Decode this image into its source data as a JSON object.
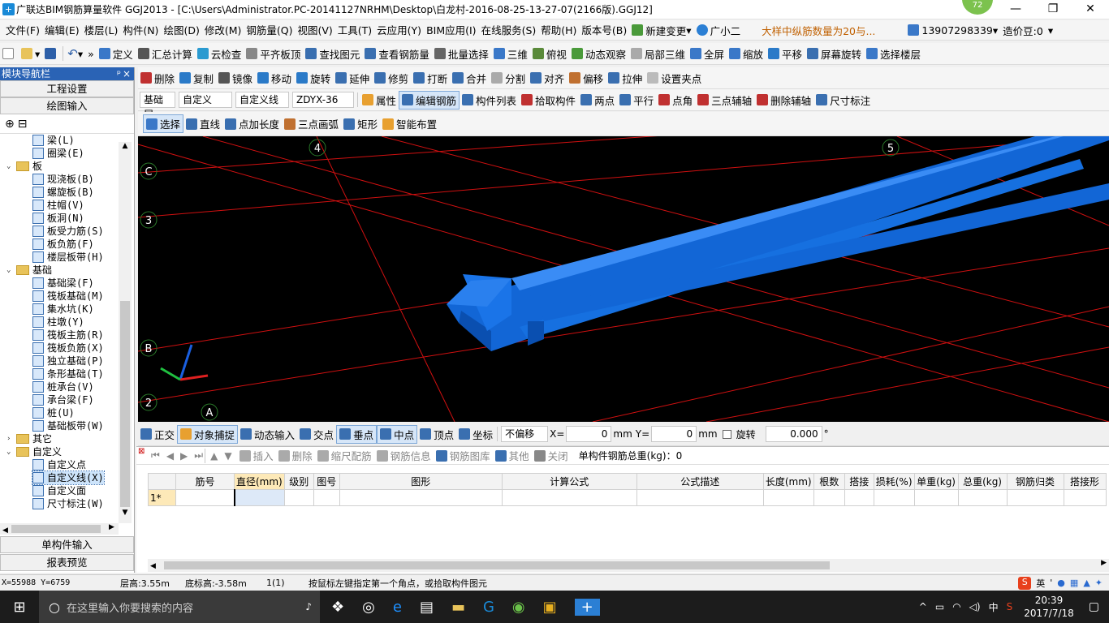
{
  "window": {
    "title": "广联达BIM钢筋算量软件 GGJ2013 - [C:\\Users\\Administrator.PC-20141127NRHM\\Desktop\\白龙村-2016-08-25-13-27-07(2166版).GGJ12]",
    "badge": "72",
    "minimize": "—",
    "restore": "❐",
    "close": "✕"
  },
  "menu": {
    "items": [
      "文件(F)",
      "编辑(E)",
      "楼层(L)",
      "构件(N)",
      "绘图(D)",
      "修改(M)",
      "钢筋量(Q)",
      "视图(V)",
      "工具(T)",
      "云应用(Y)",
      "BIM应用(I)",
      "在线服务(S)",
      "帮助(H)",
      "版本号(B)"
    ],
    "new_change": "新建变更",
    "guangxiaoer": "广小二",
    "notice": "大样中纵筋数量为20与...",
    "phone": "13907298339",
    "price_bean": "造价豆:0"
  },
  "toolbar1": {
    "items": [
      "定义",
      "汇总计算",
      "云检查",
      "平齐板顶",
      "查找图元",
      "查看钢筋量",
      "批量选择",
      "三维",
      "俯视",
      "动态观察",
      "局部三维",
      "全屏",
      "缩放",
      "平移",
      "屏幕旋转",
      "选择楼层"
    ]
  },
  "toolbar2": {
    "items": [
      "删除",
      "复制",
      "镜像",
      "移动",
      "旋转",
      "延伸",
      "修剪",
      "打断",
      "合并",
      "分割",
      "对齐",
      "偏移",
      "拉伸",
      "设置夹点"
    ]
  },
  "toolbar3": {
    "floor": "基础层",
    "category": "自定义",
    "type": "自定义线",
    "element": "ZDYX-36",
    "items": [
      "属性",
      "编辑钢筋",
      "构件列表",
      "拾取构件",
      "两点",
      "平行",
      "点角",
      "三点辅轴",
      "删除辅轴",
      "尺寸标注"
    ]
  },
  "toolbar4": {
    "items": [
      "选择",
      "直线",
      "点加长度",
      "三点画弧",
      "矩形",
      "智能布置"
    ]
  },
  "leftpanel": {
    "title": "模块导航栏",
    "pin": "ᵖ",
    "close": "×",
    "btn_project": "工程设置",
    "btn_draw": "绘图输入",
    "btn_single": "单构件输入",
    "btn_report": "报表预览",
    "tree": [
      {
        "label": "梁(L)",
        "level": 2
      },
      {
        "label": "圈梁(E)",
        "level": 2
      },
      {
        "label": "板",
        "level": 1,
        "folder": true,
        "exp": "⌄"
      },
      {
        "label": "现浇板(B)",
        "level": 2
      },
      {
        "label": "螺旋板(B)",
        "level": 2
      },
      {
        "label": "柱帽(V)",
        "level": 2
      },
      {
        "label": "板洞(N)",
        "level": 2
      },
      {
        "label": "板受力筋(S)",
        "level": 2
      },
      {
        "label": "板负筋(F)",
        "level": 2
      },
      {
        "label": "楼层板带(H)",
        "level": 2
      },
      {
        "label": "基础",
        "level": 1,
        "folder": true,
        "exp": "⌄"
      },
      {
        "label": "基础梁(F)",
        "level": 2
      },
      {
        "label": "筏板基础(M)",
        "level": 2
      },
      {
        "label": "集水坑(K)",
        "level": 2
      },
      {
        "label": "柱墩(Y)",
        "level": 2
      },
      {
        "label": "筏板主筋(R)",
        "level": 2
      },
      {
        "label": "筏板负筋(X)",
        "level": 2
      },
      {
        "label": "独立基础(P)",
        "level": 2
      },
      {
        "label": "条形基础(T)",
        "level": 2
      },
      {
        "label": "桩承台(V)",
        "level": 2
      },
      {
        "label": "承台梁(F)",
        "level": 2
      },
      {
        "label": "桩(U)",
        "level": 2
      },
      {
        "label": "基础板带(W)",
        "level": 2
      },
      {
        "label": "其它",
        "level": 1,
        "folder": true,
        "exp": "›"
      },
      {
        "label": "自定义",
        "level": 1,
        "folder": true,
        "exp": "⌄"
      },
      {
        "label": "自定义点",
        "level": 2
      },
      {
        "label": "自定义线(X)",
        "level": 2,
        "selected": true
      },
      {
        "label": "自定义面",
        "level": 2
      },
      {
        "label": "尺寸标注(W)",
        "level": 2
      }
    ]
  },
  "canvas": {
    "axis_labels": [
      "4",
      "5",
      "C",
      "3",
      "B",
      "2",
      "A"
    ]
  },
  "snapbar": {
    "items": [
      "正交",
      "对象捕捉",
      "动态输入",
      "交点",
      "垂点",
      "中点",
      "顶点",
      "坐标"
    ],
    "offset_mode": "不偏移",
    "x_label": "X=",
    "x_value": "0",
    "y_label": "Y=",
    "y_value": "0",
    "unit": "mm",
    "rotate_label": "旋转",
    "rotate_value": "0.000",
    "degree": "°"
  },
  "rebar_toolbar": {
    "items": [
      "插入",
      "删除",
      "缩尺配筋",
      "钢筋信息",
      "钢筋图库",
      "其他",
      "关闭"
    ],
    "total": "单构件钢筋总重(kg)：0"
  },
  "rebar_table": {
    "columns": [
      "筋号",
      "直径(mm)",
      "级别",
      "图号",
      "图形",
      "计算公式",
      "公式描述",
      "长度(mm)",
      "根数",
      "搭接",
      "损耗(%)",
      "单重(kg)",
      "总重(kg)",
      "钢筋归类",
      "搭接形"
    ],
    "rows": [
      {
        "num": "1*"
      }
    ]
  },
  "status": {
    "coords": "X=55988 Y=6759",
    "floor_height": "层高:3.55m",
    "bottom_height": "底标高:-3.58m",
    "count": "1(1)",
    "hint": "按鼠标左键指定第一个角点，或拾取构件图元"
  },
  "taskbar": {
    "search_placeholder": "在这里输入你要搜索的内容",
    "ime_lang": "英",
    "ime_cn": "中",
    "time": "20:39",
    "date": "2017/7/18"
  }
}
